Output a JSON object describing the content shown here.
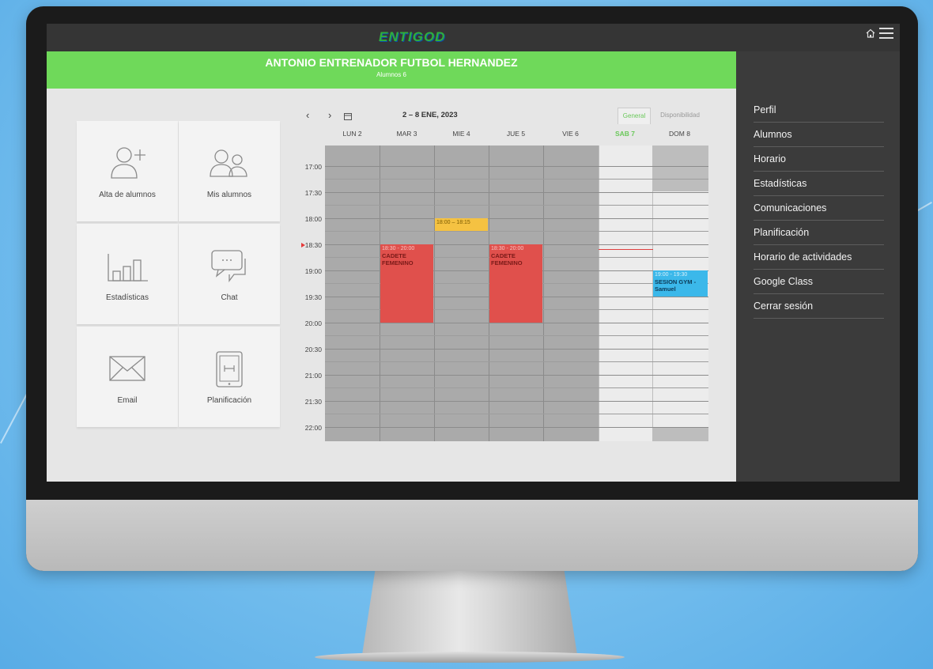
{
  "header": {
    "logo_text": "ENTIGOD",
    "coach_name": "ANTONIO ENTRENADOR FUTBOL HERNANDEZ",
    "students_count": "Alumnos 6"
  },
  "top_icons": [
    "home-icon",
    "menu-icon"
  ],
  "tiles": [
    {
      "label": "Alta de alumnos",
      "icon": "add-user-icon"
    },
    {
      "label": "Mis alumnos",
      "icon": "users-icon"
    },
    {
      "label": "Estadísticas",
      "icon": "bar-chart-icon"
    },
    {
      "label": "Chat",
      "icon": "chat-icon"
    },
    {
      "label": "Email",
      "icon": "envelope-icon"
    },
    {
      "label": "Planificación",
      "icon": "tablet-icon"
    }
  ],
  "calendar": {
    "nav_prev": "‹",
    "nav_next": "›",
    "range": "2 – 8 ENE, 2023",
    "tabs": [
      "General",
      "Disponibilidad"
    ],
    "active_tab": "General",
    "days": [
      "LUN 2",
      "MAR 3",
      "MIE 4",
      "JUE 5",
      "VIE 6",
      "SAB 7",
      "DOM 8"
    ],
    "today": "SAB 7",
    "times": [
      "17:00",
      "17:30",
      "18:00",
      "18:30",
      "19:00",
      "19:30",
      "20:00",
      "20:30",
      "21:00",
      "21:30",
      "22:00"
    ],
    "events": [
      {
        "day": "MIE 4",
        "time": "18:00 – 18:15",
        "title": "",
        "color": "#f5c242"
      },
      {
        "day": "MAR 3",
        "time": "18:30 - 20:00",
        "title": "CADETE FEMENINO",
        "color": "#e0504c"
      },
      {
        "day": "JUE 5",
        "time": "18:30 - 20:00",
        "title": "CADETE FEMENINO",
        "color": "#e0504c"
      },
      {
        "day": "DOM 8",
        "time": "19:00 - 19:30",
        "title": "SESION GYM - Samuel",
        "color": "#3bb8ea"
      }
    ]
  },
  "sidebar": {
    "items": [
      "Perfil",
      "Alumnos",
      "Horario",
      "Estadísticas",
      "Comunicaciones",
      "Planificación",
      "Horario de actividades",
      "Google Class",
      "Cerrar sesión"
    ]
  },
  "colors": {
    "accent_green": "#6fd95a",
    "sidebar": "#3b3b3b",
    "topbar": "#353535"
  }
}
